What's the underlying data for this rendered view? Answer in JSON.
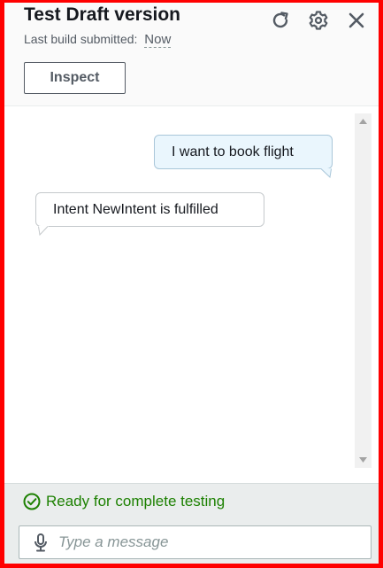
{
  "header": {
    "title": "Test Draft version",
    "build_label": "Last build submitted:",
    "build_value": "Now",
    "inspect_label": "Inspect",
    "icons": [
      "refresh-icon",
      "settings-gear-icon",
      "close-icon"
    ]
  },
  "chat": {
    "messages": [
      {
        "from": "user",
        "text": "I want to book flight"
      },
      {
        "from": "bot",
        "text": "Intent NewIntent is fulfilled"
      }
    ]
  },
  "footer": {
    "status_text": "Ready for complete testing",
    "input_placeholder": "Type a message",
    "input_value": ""
  },
  "colors": {
    "frame_border": "#ff0000",
    "status_green": "#1d8102",
    "user_bubble_bg": "#eaf6fd",
    "footer_bg": "#eaeded"
  }
}
